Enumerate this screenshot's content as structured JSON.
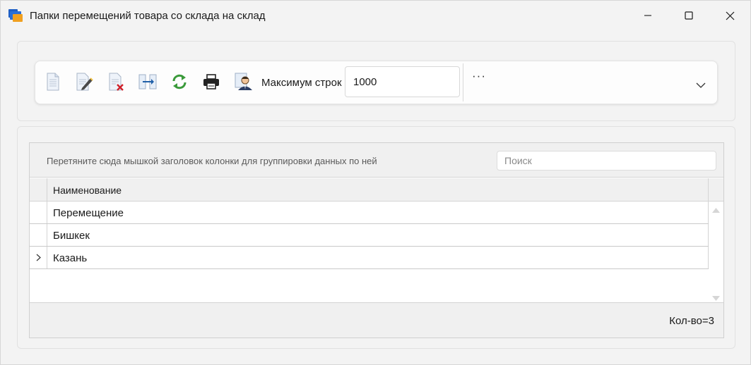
{
  "window": {
    "title": "Папки перемещений товара со склада на склад",
    "icon": "folder-icon",
    "controls": [
      "minimize-icon",
      "maximize-icon",
      "close-icon"
    ]
  },
  "toolbar": {
    "buttons": [
      {
        "icon": "new-document-icon"
      },
      {
        "icon": "edit-document-icon"
      },
      {
        "icon": "delete-document-icon"
      },
      {
        "icon": "move-icon"
      },
      {
        "icon": "refresh-icon"
      },
      {
        "icon": "print-icon"
      },
      {
        "icon": "user-icon"
      }
    ],
    "max_rows_label": "Максимум строк",
    "max_rows_value": "1000",
    "more_label": "···"
  },
  "grid": {
    "group_hint": "Перетяните сюда мышкой заголовок колонки для группировки данных по ней",
    "search_placeholder": "Поиск",
    "columns": [
      "Наименование"
    ],
    "rows": [
      {
        "name": "Перемещение",
        "expandable": false
      },
      {
        "name": "Бишкек",
        "expandable": false
      },
      {
        "name": "Казань",
        "expandable": true
      }
    ],
    "footer_count": "Кол-во=3"
  },
  "colors": {
    "accent_green": "#3a9a3a",
    "delete_red": "#d0202a",
    "folder_blue": "#2a6fd6",
    "folder_orange": "#f0a020"
  }
}
